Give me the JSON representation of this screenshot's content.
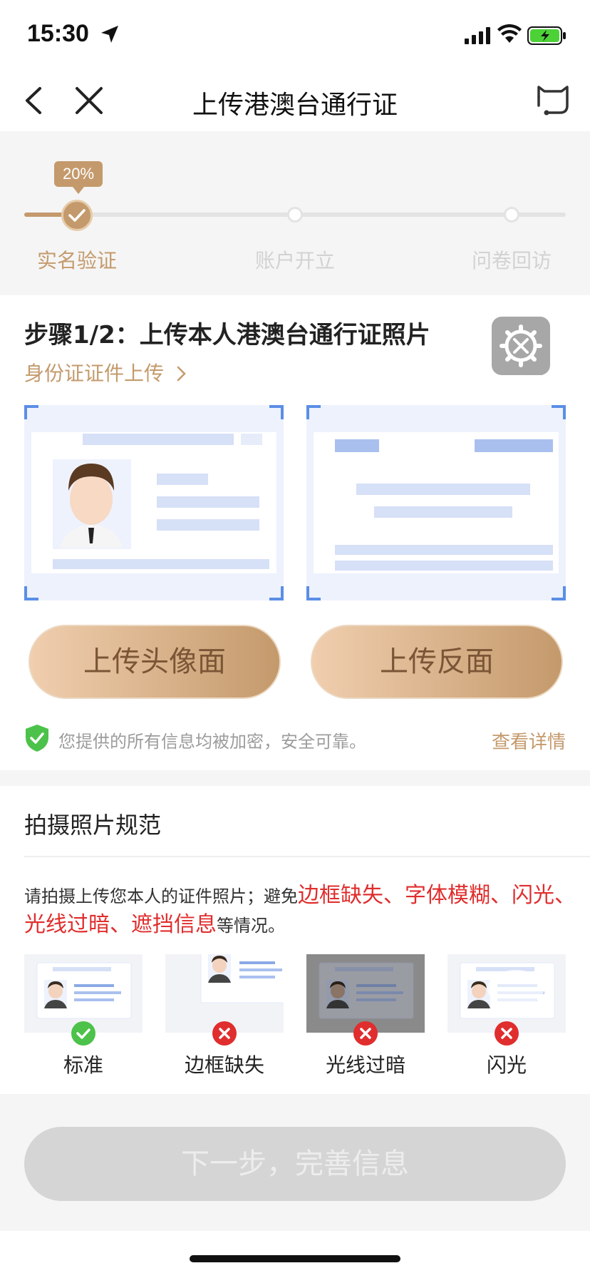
{
  "status_bar": {
    "time": "15:30"
  },
  "nav": {
    "title": "上传港澳台通行证"
  },
  "progress": {
    "percent_label": "20%",
    "percent": 20,
    "steps": [
      {
        "label": "实名验证",
        "state": "done"
      },
      {
        "label": "账户开立",
        "state": "pending"
      },
      {
        "label": "问卷回访",
        "state": "pending"
      }
    ]
  },
  "upload": {
    "title": "步骤1/2：上传本人港澳台通行证照片",
    "id_card_link": "身份证证件上传",
    "front_button": "上传头像面",
    "back_button": "上传反面",
    "security_text": "您提供的所有信息均被加密，安全可靠。",
    "details_link": "查看详情"
  },
  "guide": {
    "title": "拍摄照片规范",
    "text_prefix": "请拍摄上传您本人的证件照片；避免",
    "text_highlight": "边框缺失、字体模糊、闪光、光线过暗、遮挡信息",
    "text_suffix": "等情况。",
    "samples": [
      {
        "label": "标准",
        "status": "ok"
      },
      {
        "label": "边框缺失",
        "status": "error"
      },
      {
        "label": "光线过暗",
        "status": "error"
      },
      {
        "label": "闪光",
        "status": "error"
      }
    ]
  },
  "next_button": "下一步，完善信息",
  "colors": {
    "accent": "#c49a6c",
    "error": "#e02d2d",
    "ok": "#4cc24a",
    "frame_blue": "#5b8ee6"
  }
}
